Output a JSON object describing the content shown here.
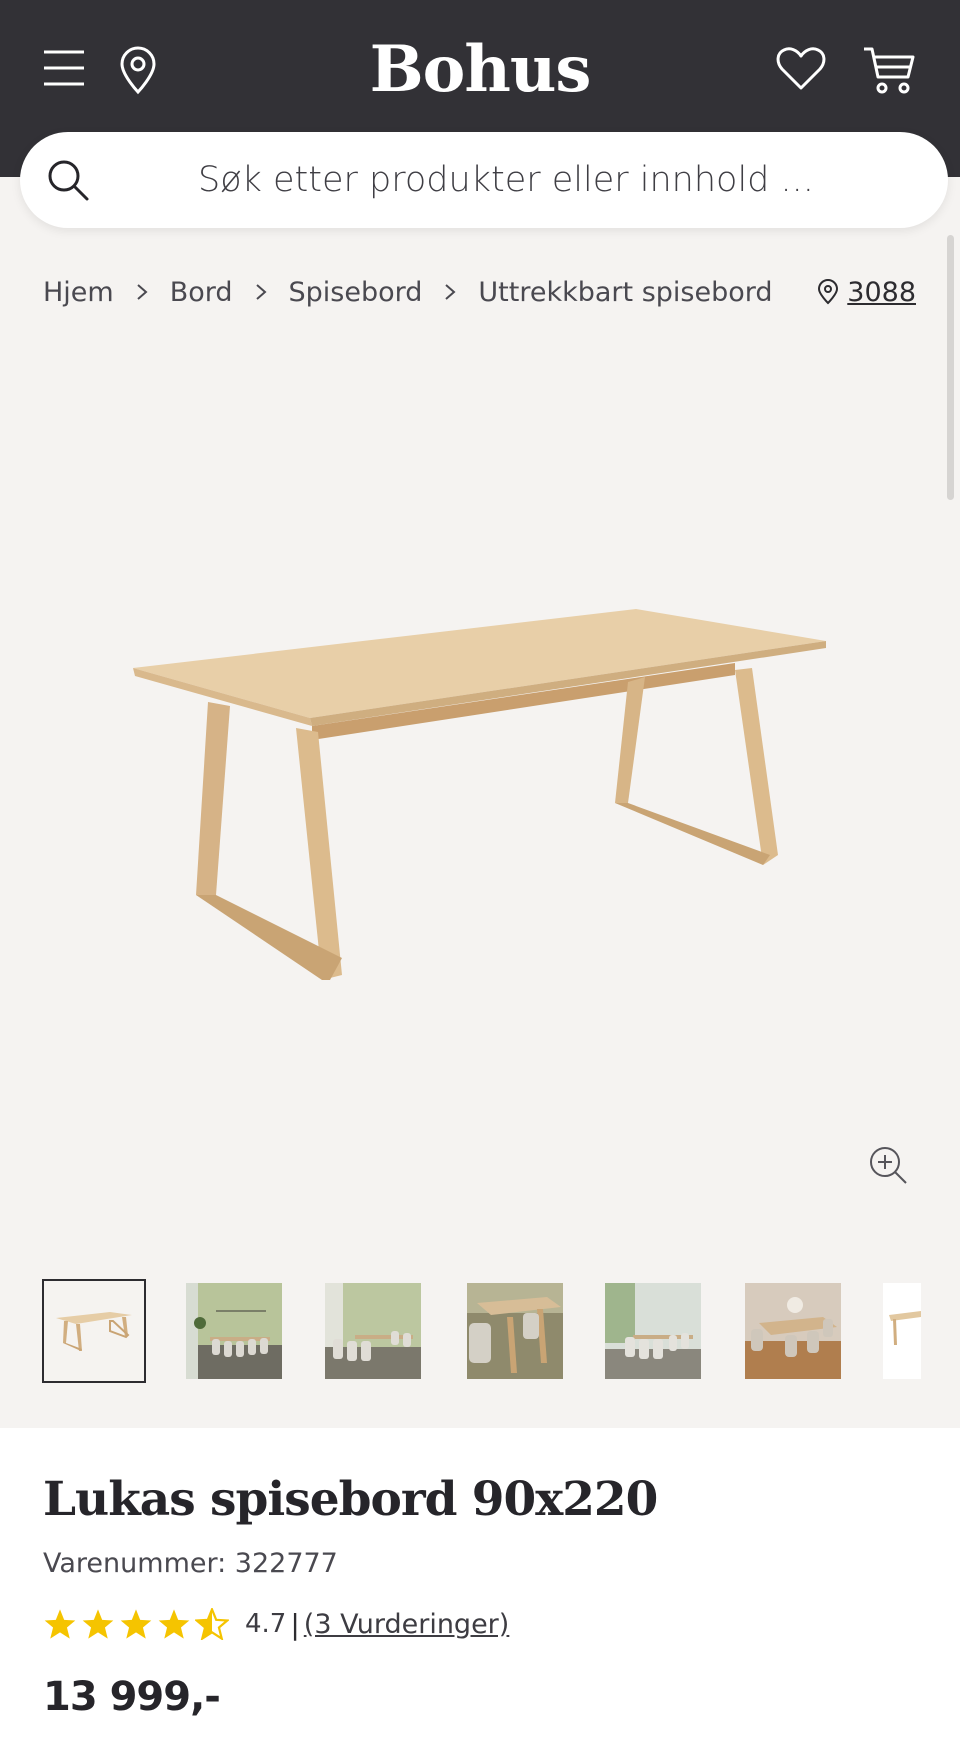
{
  "header": {
    "logo": "Bohus",
    "menu_icon": "hamburger-menu-icon",
    "location_icon": "map-pin-icon",
    "wishlist_icon": "heart-icon",
    "cart_icon": "shopping-cart-icon",
    "background": "#323136"
  },
  "search": {
    "placeholder": "Søk etter produkter eller innhold ...",
    "icon": "search-icon"
  },
  "breadcrumb": {
    "items": [
      "Hjem",
      "Bord",
      "Spisebord",
      "Uttrekkbart spisebord"
    ],
    "separator_icon": "chevron-right-icon"
  },
  "store": {
    "icon": "map-pin-icon",
    "number": "3088"
  },
  "gallery": {
    "main_image": "oak-dining-table-photo",
    "zoom_icon": "zoom-in-icon",
    "thumbnails": [
      "table-cutout",
      "dining-room-green-wall",
      "dining-room-green-wall-2",
      "table-closeup-chairs",
      "dining-room-window",
      "dining-room-wood-floor",
      "table-cutout-partial"
    ]
  },
  "product": {
    "title": "Lukas spisebord 90x220",
    "sku_label": "Varenummer: 322777",
    "rating_value": "4.7",
    "rating_separator": "|",
    "rating_link": "(3 Vurderinger)",
    "rating_stars": 4.5,
    "price": "13 999,-",
    "star_color": "#f5c400"
  }
}
